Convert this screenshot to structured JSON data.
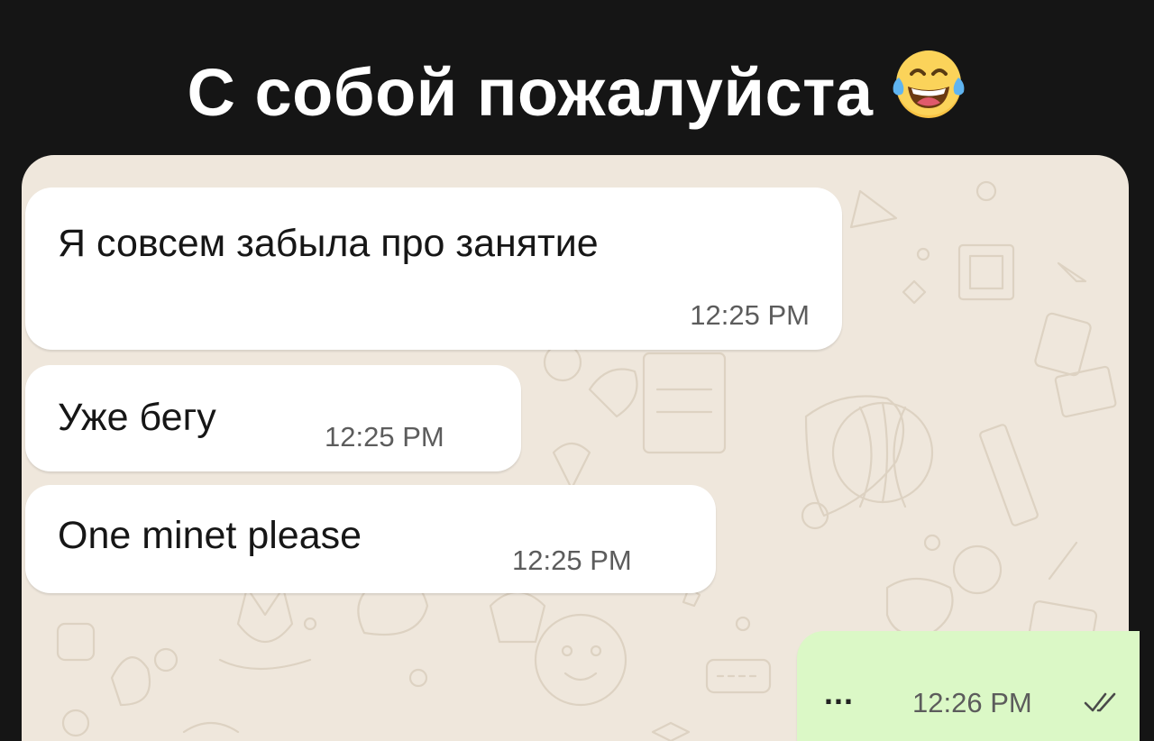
{
  "caption": {
    "text": "С собой пожалуйста",
    "emoji_icon": "tears-of-joy-emoji-icon"
  },
  "chat": {
    "wallpaper_color": "#efe7dc",
    "incoming_bubble_color": "#ffffff",
    "outgoing_bubble_color": "#dbf8c6",
    "messages": [
      {
        "direction": "incoming",
        "text": "Я совсем забыла про занятие",
        "time": "12:25 PM"
      },
      {
        "direction": "incoming",
        "text": "Уже бегу",
        "time": "12:25 PM"
      },
      {
        "direction": "incoming",
        "text": "One minet please",
        "time": "12:25 PM"
      },
      {
        "direction": "outgoing",
        "text": "...",
        "time": "12:26 PM",
        "status_icon": "double-check-read-icon"
      }
    ]
  }
}
